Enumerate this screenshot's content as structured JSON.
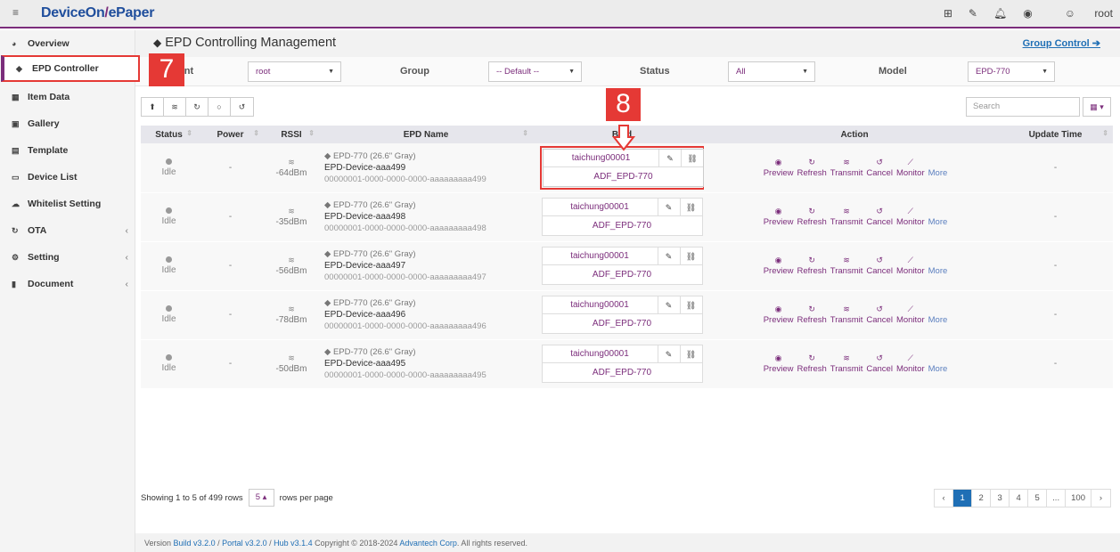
{
  "app": {
    "brand_a": "DeviceOn",
    "brand_sep": "/",
    "brand_b": "ePaper",
    "user": "root"
  },
  "sidebar": {
    "items": [
      {
        "label": "Overview",
        "icon": "gauge-icon"
      },
      {
        "label": "EPD Controller",
        "icon": "tags-icon"
      },
      {
        "label": "Item Data",
        "icon": "table-icon"
      },
      {
        "label": "Gallery",
        "icon": "image-icon"
      },
      {
        "label": "Template",
        "icon": "card-icon"
      },
      {
        "label": "Device List",
        "icon": "monitor-icon"
      },
      {
        "label": "Whitelist Setting",
        "icon": "cloud-icon"
      },
      {
        "label": "OTA",
        "icon": "refresh-icon"
      },
      {
        "label": "Setting",
        "icon": "cogs-icon"
      },
      {
        "label": "Document",
        "icon": "book-icon"
      }
    ]
  },
  "page": {
    "title": "EPD Controlling Management",
    "group_control": "Group Control ➔"
  },
  "filters": {
    "account_label": "unt",
    "account_value": "root",
    "group_label": "Group",
    "group_value": "-- Default --",
    "status_label": "Status",
    "status_value": "All",
    "model_label": "Model",
    "model_value": "EPD-770"
  },
  "search": {
    "placeholder": "Search"
  },
  "table": {
    "headers": [
      "Status",
      "Power",
      "RSSI",
      "EPD Name",
      "Bind",
      "Action",
      "Update Time"
    ],
    "rows": [
      {
        "status": "Idle",
        "power": "-",
        "rssi": "-64dBm",
        "model": "EPD-770 (26.6\" Gray)",
        "name": "EPD-Device-aaa499",
        "uuid": "00000001-0000-0000-0000-aaaaaaaaa499",
        "location": "taichung00001",
        "bind_model": "ADF_EPD-770",
        "update": "-"
      },
      {
        "status": "Idle",
        "power": "-",
        "rssi": "-35dBm",
        "model": "EPD-770 (26.6\" Gray)",
        "name": "EPD-Device-aaa498",
        "uuid": "00000001-0000-0000-0000-aaaaaaaaa498",
        "location": "taichung00001",
        "bind_model": "ADF_EPD-770",
        "update": "-"
      },
      {
        "status": "Idle",
        "power": "-",
        "rssi": "-56dBm",
        "model": "EPD-770 (26.6\" Gray)",
        "name": "EPD-Device-aaa497",
        "uuid": "00000001-0000-0000-0000-aaaaaaaaa497",
        "location": "taichung00001",
        "bind_model": "ADF_EPD-770",
        "update": "-"
      },
      {
        "status": "Idle",
        "power": "-",
        "rssi": "-78dBm",
        "model": "EPD-770 (26.6\" Gray)",
        "name": "EPD-Device-aaa496",
        "uuid": "00000001-0000-0000-0000-aaaaaaaaa496",
        "location": "taichung00001",
        "bind_model": "ADF_EPD-770",
        "update": "-"
      },
      {
        "status": "Idle",
        "power": "-",
        "rssi": "-50dBm",
        "model": "EPD-770 (26.6\" Gray)",
        "name": "EPD-Device-aaa495",
        "uuid": "00000001-0000-0000-0000-aaaaaaaaa495",
        "location": "taichung00001",
        "bind_model": "ADF_EPD-770",
        "update": "-"
      }
    ],
    "actions": [
      "Preview",
      "Refresh",
      "Transmit",
      "Cancel",
      "Monitor"
    ],
    "more_label": "More"
  },
  "pagination": {
    "showing": "Showing 1 to 5 of 499 rows",
    "page_size": "5 ▴",
    "rows_per_page": "rows per page",
    "prev": "‹",
    "pages": [
      "1",
      "2",
      "3",
      "4",
      "5",
      "...",
      "100"
    ],
    "next": "›"
  },
  "footer": {
    "version_label": "Version",
    "build": "Build v3.2.0",
    "sep1": " / ",
    "portal": "Portal v3.2.0",
    "sep2": " / ",
    "hub": "Hub v3.1.4",
    "copyright": " Copyright © 2018-2024 ",
    "company": "Advantech Corp",
    "rights": ". All rights reserved."
  },
  "callouts": {
    "step7": "7",
    "step8": "8"
  },
  "colors": {
    "accent": "#7b2d7b",
    "brand": "#1f4e9c",
    "link": "#1f6fb5",
    "highlight": "#e53935"
  }
}
